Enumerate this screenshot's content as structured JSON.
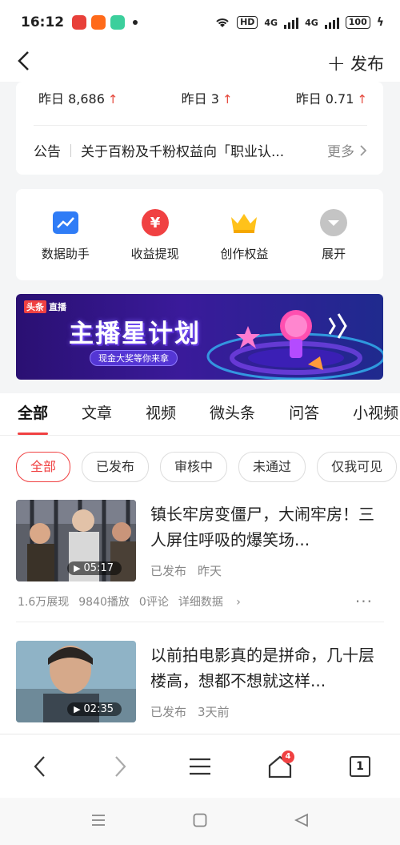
{
  "status_bar": {
    "time": "16:12",
    "wifi_label": "HD",
    "signal1": "4G",
    "signal2": "4G",
    "battery": "100"
  },
  "top_nav": {
    "back_icon": "chevron-left-icon",
    "publish_label": "发布"
  },
  "stats": {
    "items": [
      {
        "label": "昨日 8,686",
        "trend": "up"
      },
      {
        "label": "昨日 3",
        "trend": "up"
      },
      {
        "label": "昨日 0.71",
        "trend": "up"
      }
    ]
  },
  "notice": {
    "label": "公告",
    "text": "关于百粉及千粉权益向「职业认...",
    "more": "更多"
  },
  "tools": [
    {
      "label": "数据助手",
      "icon": "chart-icon",
      "color": "#2f7cf6"
    },
    {
      "label": "收益提现",
      "icon": "yuan-icon",
      "color": "#f04142"
    },
    {
      "label": "创作权益",
      "icon": "crown-icon",
      "color": "#ffc21a"
    },
    {
      "label": "展开",
      "icon": "expand-icon",
      "color": "#bdbdbd"
    }
  ],
  "banner": {
    "tag1": "头条",
    "tag2": "直播",
    "title": "主播星计划",
    "subtitle": "现金大奖等你来拿"
  },
  "tabs": [
    "全部",
    "文章",
    "视频",
    "微头条",
    "问答",
    "小视频"
  ],
  "filters": [
    "全部",
    "已发布",
    "审核中",
    "未通过",
    "仅我可见"
  ],
  "articles": [
    {
      "title": "镇长牢房变僵尸，大闹牢房！三人屏住呼吸的爆笑场...",
      "duration": "05:17",
      "status": "已发布",
      "time": "昨天",
      "impressions": "1.6万展现",
      "plays": "9840播放",
      "comments": "0评论",
      "detail": "详细数据"
    },
    {
      "title": "以前拍电影真的是拼命，几十层楼高，想都不想就这样...",
      "duration": "02:35",
      "status": "已发布",
      "time": "3天前"
    }
  ],
  "browser_bar": {
    "tab_count": "1",
    "home_badge": "4"
  },
  "colors": {
    "accent": "#f04142",
    "text": "#222222",
    "muted": "#888888"
  }
}
